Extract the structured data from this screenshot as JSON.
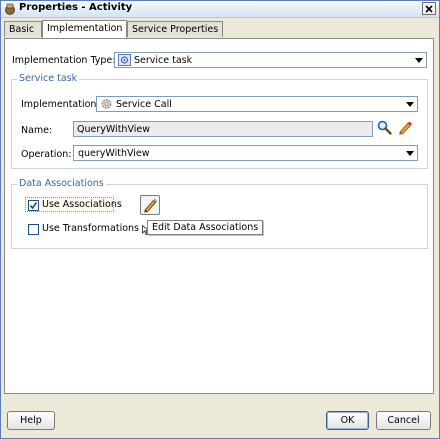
{
  "window": {
    "title": "Properties - Activity"
  },
  "tabs": [
    {
      "label": "Basic"
    },
    {
      "label": "Implementation"
    },
    {
      "label": "Service Properties"
    }
  ],
  "implementation_type": {
    "label": "Implementation Type:",
    "value": "Service task",
    "icon": "gear-service-icon"
  },
  "service_task": {
    "title": "Service task",
    "implementation": {
      "label": "Implementation:",
      "value": "Service Call",
      "icon": "gear-icon"
    },
    "name": {
      "label": "Name:",
      "value": "QueryWithView"
    },
    "operation": {
      "label": "Operation:",
      "value": "queryWithView"
    }
  },
  "data_associations": {
    "title": "Data Associations",
    "use_associations": {
      "label": "Use Associations",
      "checked": true
    },
    "use_transformations": {
      "label": "Use Transformations",
      "checked": false
    },
    "tooltip": "Edit Data Associations"
  },
  "buttons": {
    "help": "Help",
    "ok": "OK",
    "cancel": "Cancel"
  },
  "colors": {
    "group_title": "#3a62a6",
    "dialog_bg": "#ece9d8",
    "field_border": "#7f9db9"
  }
}
